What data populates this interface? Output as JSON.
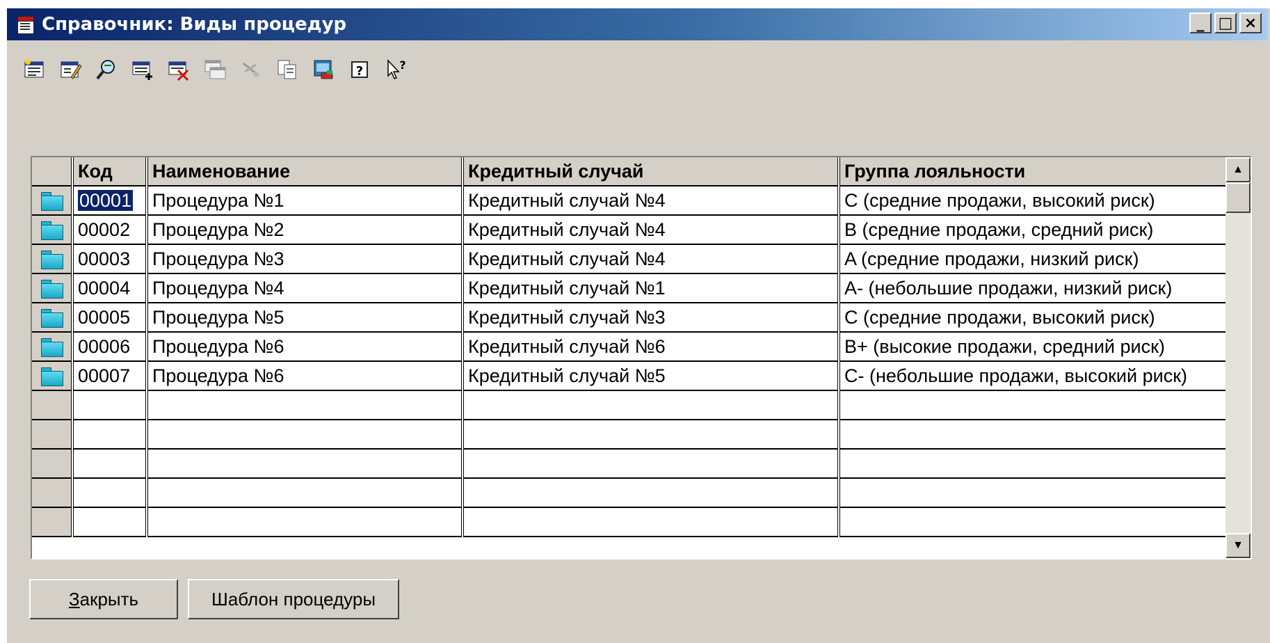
{
  "window": {
    "title": "Справочник: Виды процедур",
    "controls": {
      "minimize": "_",
      "maximize": "□",
      "close": "×"
    }
  },
  "toolbar": {
    "icons": [
      "new-element-icon",
      "edit-element-icon",
      "find-icon",
      "add-row-icon",
      "delete-row-icon",
      "copy-row-icon",
      "move-icon",
      "copy-icon",
      "print-icon",
      "help-icon",
      "context-help-icon"
    ]
  },
  "grid": {
    "columns": [
      "Код",
      "Наименование",
      "Кредитный случай",
      "Группа лояльности"
    ],
    "rows": [
      {
        "code": "00001",
        "name": "Процедура №1",
        "credit": "Кредитный случай №4",
        "group": "C (средние продажи, высокий риск)"
      },
      {
        "code": "00002",
        "name": "Процедура №2",
        "credit": "Кредитный случай №4",
        "group": "B (средние продажи, средний риск)"
      },
      {
        "code": "00003",
        "name": "Процедура №3",
        "credit": "Кредитный случай №4",
        "group": "A (средние продажи, низкий риск)"
      },
      {
        "code": "00004",
        "name": "Процедура №4",
        "credit": "Кредитный случай №1",
        "group": "A- (небольшие продажи, низкий риск)"
      },
      {
        "code": "00005",
        "name": "Процедура №5",
        "credit": "Кредитный случай №3",
        "group": "C (средние продажи, высокий риск)"
      },
      {
        "code": "00006",
        "name": "Процедура №6",
        "credit": "Кредитный случай №6",
        "group": "B+ (высокие продажи, средний риск)"
      },
      {
        "code": "00007",
        "name": "Процедура №6",
        "credit": "Кредитный случай №5",
        "group": "C- (небольшие продажи, высокий риск)"
      }
    ],
    "selected_row": 0
  },
  "buttons": {
    "close_accel": "З",
    "close_rest": "акрыть",
    "template": "Шаблон процедуры"
  }
}
